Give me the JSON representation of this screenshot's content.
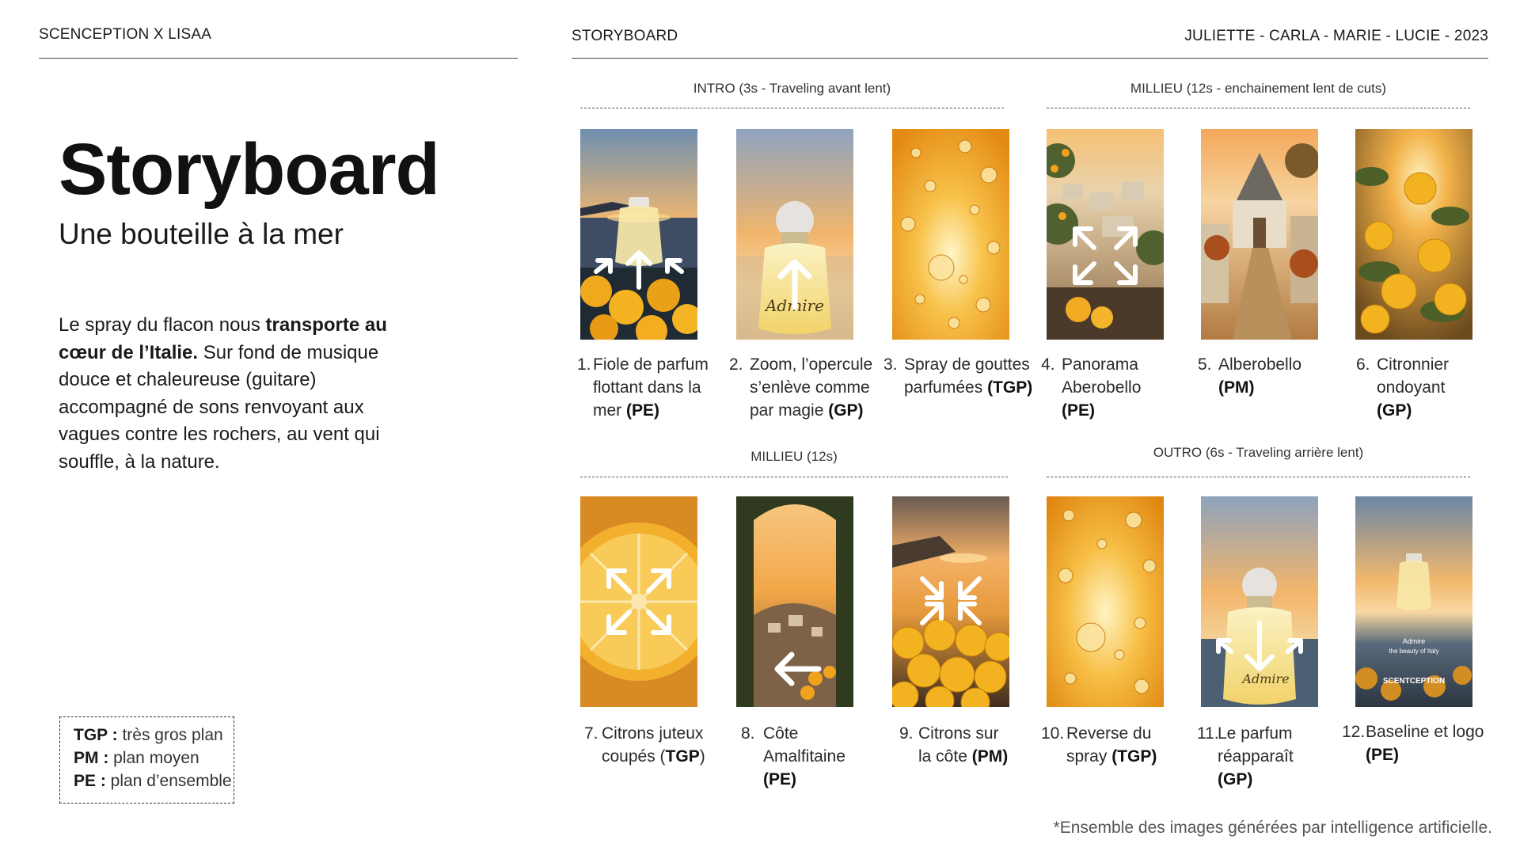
{
  "header": {
    "left": "SCENCEPTION X LISAA",
    "center": "STORYBOARD",
    "right": "JULIETTE - CARLA - MARIE - LUCIE - 2023"
  },
  "intro": {
    "title": "Storyboard",
    "subtitle": "Une bouteille à la mer",
    "description": {
      "p1": "Le spray du flacon nous ",
      "bold1": "transporte au",
      "bold2": "cœur de l’Italie.",
      "p2": " Sur fond de musique",
      "p3": "douce et chaleureuse (guitare)",
      "p4": "accompagné de sons renvoyant aux",
      "p5": "vagues contre les rochers, au vent qui",
      "p6": "souffle, à la nature."
    }
  },
  "legend": [
    {
      "abbr": "TGP :",
      "text": " très gros plan"
    },
    {
      "abbr": "PM :",
      "text": " plan moyen"
    },
    {
      "abbr": "PE :",
      "text": " plan d’ensemble"
    }
  ],
  "sections": {
    "intro": "INTRO (3s - Traveling avant lent)",
    "millieu1": "MILLIEU (12s - enchainement lent de cuts)",
    "millieu2": "MILLIEU (12s)",
    "outro": "OUTRO (6s - Traveling arrière lent)"
  },
  "frames": [
    {
      "num": "1.",
      "lines": [
        "Fiole de parfum",
        "flottant dans la"
      ],
      "last": "mer ",
      "tag": "(PE)",
      "icon": "arrows-up-out-icon"
    },
    {
      "num": "2.",
      "lines": [
        "Zoom, l’opercule",
        "s’enlève comme"
      ],
      "last": "par magie ",
      "tag": "(GP)",
      "icon": "arrow-up-icon"
    },
    {
      "num": "3.",
      "lines": [
        "Spray de gouttes"
      ],
      "last": "parfumées ",
      "tag": "(TGP)",
      "icon": ""
    },
    {
      "num": "4.",
      "lines": [
        "Panorama",
        "Aberobello"
      ],
      "last": "",
      "tag": "(PE)",
      "icon": "expand-arrows-icon"
    },
    {
      "num": "5.",
      "lines": [
        "Alberobello"
      ],
      "last": "",
      "tag": "(PM)",
      "icon": ""
    },
    {
      "num": "6.",
      "lines": [
        "Citronnier",
        "ondoyant"
      ],
      "last": "",
      "tag": "(GP)",
      "icon": ""
    },
    {
      "num": "7.",
      "lines": [
        "Citrons juteux"
      ],
      "last": "coupés (",
      "tag": "TGP",
      "tail": ")",
      "icon": "expand-arrows-icon"
    },
    {
      "num": "8.",
      "lines": [
        "Côte",
        "Amalfitaine"
      ],
      "last": "",
      "tag": "(PE)",
      "icon": "arrow-left-icon"
    },
    {
      "num": "9.",
      "lines": [
        "Citrons sur"
      ],
      "last": "la côte ",
      "tag": "(PM)",
      "icon": "collapse-arrows-icon"
    },
    {
      "num": "10.",
      "lines": [
        "Reverse du"
      ],
      "last": "spray ",
      "tag": "(TGP)",
      "icon": ""
    },
    {
      "num": "11.",
      "lines": [
        "Le parfum",
        "réapparaît"
      ],
      "last": "",
      "tag": "(GP)",
      "icon": "arrows-down-in-icon"
    },
    {
      "num": "12.",
      "lines": [
        "Baseline et logo"
      ],
      "last": "",
      "tag": "(PE)",
      "icon": ""
    }
  ],
  "frame_texts": {
    "logo": "Admire",
    "logo_sub": "Beauty of Italy",
    "baseline_1": "Admire",
    "baseline_2": "the beauty of Italy",
    "brand": "SCENTCEPTION"
  },
  "footnote": "*Ensemble des images générées par intelligence artificielle.",
  "colors": {
    "orange": "#f2a11a",
    "gold": "#f6c345",
    "sky": "#f3b86a",
    "sea": "#3d4f63",
    "rule": "#4a4a4a"
  }
}
